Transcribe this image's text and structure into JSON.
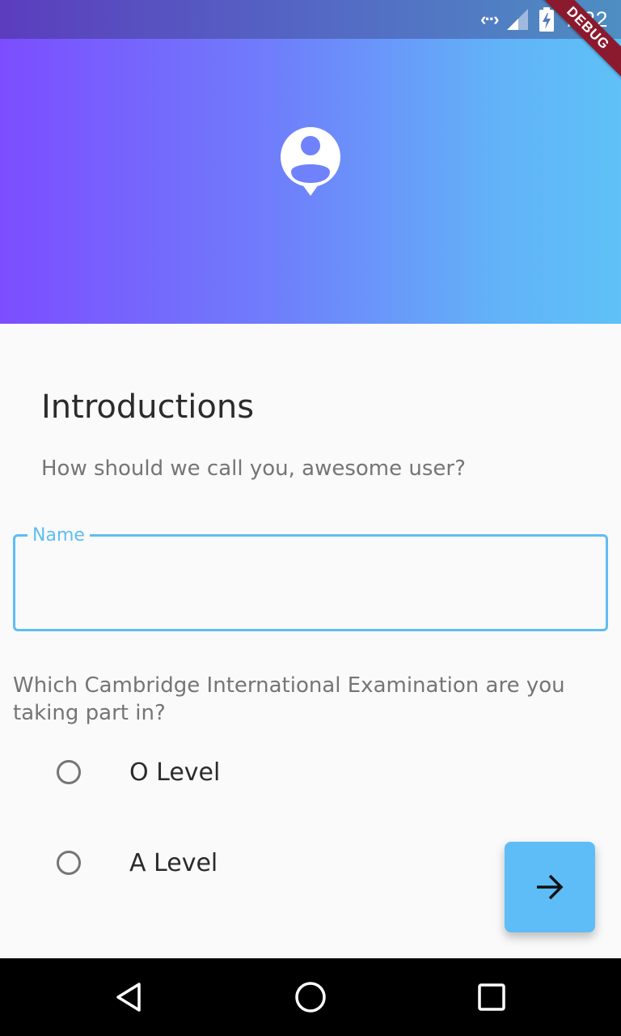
{
  "status_bar": {
    "time": "7:22",
    "icons": [
      "data-transfer-icon",
      "cell-signal-icon",
      "battery-charging-icon"
    ]
  },
  "debug_banner": {
    "label": "DEBUG"
  },
  "header": {
    "icon": "account-pin-icon",
    "colors": {
      "gradient_start": "#7c4dff",
      "gradient_end": "#5ec1f7"
    }
  },
  "content": {
    "title": "Introductions",
    "subtitle": "How should we call you, awesome user?",
    "name_field": {
      "label": "Name",
      "value": "",
      "accent_color": "#5ebdf3"
    },
    "exam_question": "Which Cambridge International Examination are you taking part in?",
    "exam_options": [
      {
        "label": "O Level",
        "selected": false
      },
      {
        "label": "A Level",
        "selected": false
      }
    ]
  },
  "fab": {
    "icon": "arrow-forward-icon",
    "color": "#5ebdf7"
  },
  "nav_bar": {
    "buttons": [
      "back-icon",
      "home-icon",
      "recents-icon"
    ]
  }
}
